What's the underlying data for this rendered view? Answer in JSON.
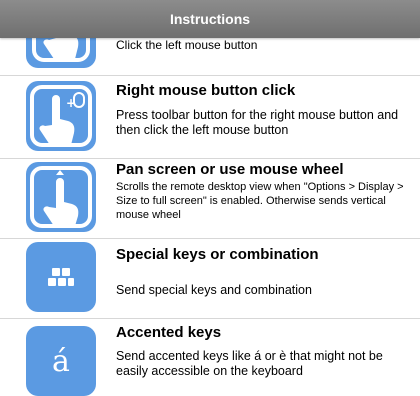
{
  "header": {
    "title": "Instructions"
  },
  "items": [
    {
      "title": "",
      "desc": "Click the left mouse button",
      "icon": "touch-finger-icon"
    },
    {
      "title": "Right mouse button click",
      "desc": "Press toolbar button for the right mouse button and then click the left mouse button",
      "icon": "right-mouse-click-icon"
    },
    {
      "title": "Pan screen or use mouse wheel",
      "desc": "Scrolls the remote desktop view when \"Options > Display > Size to full screen\" is enabled. Otherwise sends vertical mouse wheel",
      "icon": "pan-scroll-icon"
    },
    {
      "title": "Special keys or combination",
      "desc": "Send special keys and combination",
      "icon": "special-keys-icon"
    },
    {
      "title": "Accented keys",
      "desc": "Send accented keys like á or è that might not be easily accessible on the keyboard",
      "icon": "accented-keys-icon",
      "glyph": "á"
    }
  ]
}
